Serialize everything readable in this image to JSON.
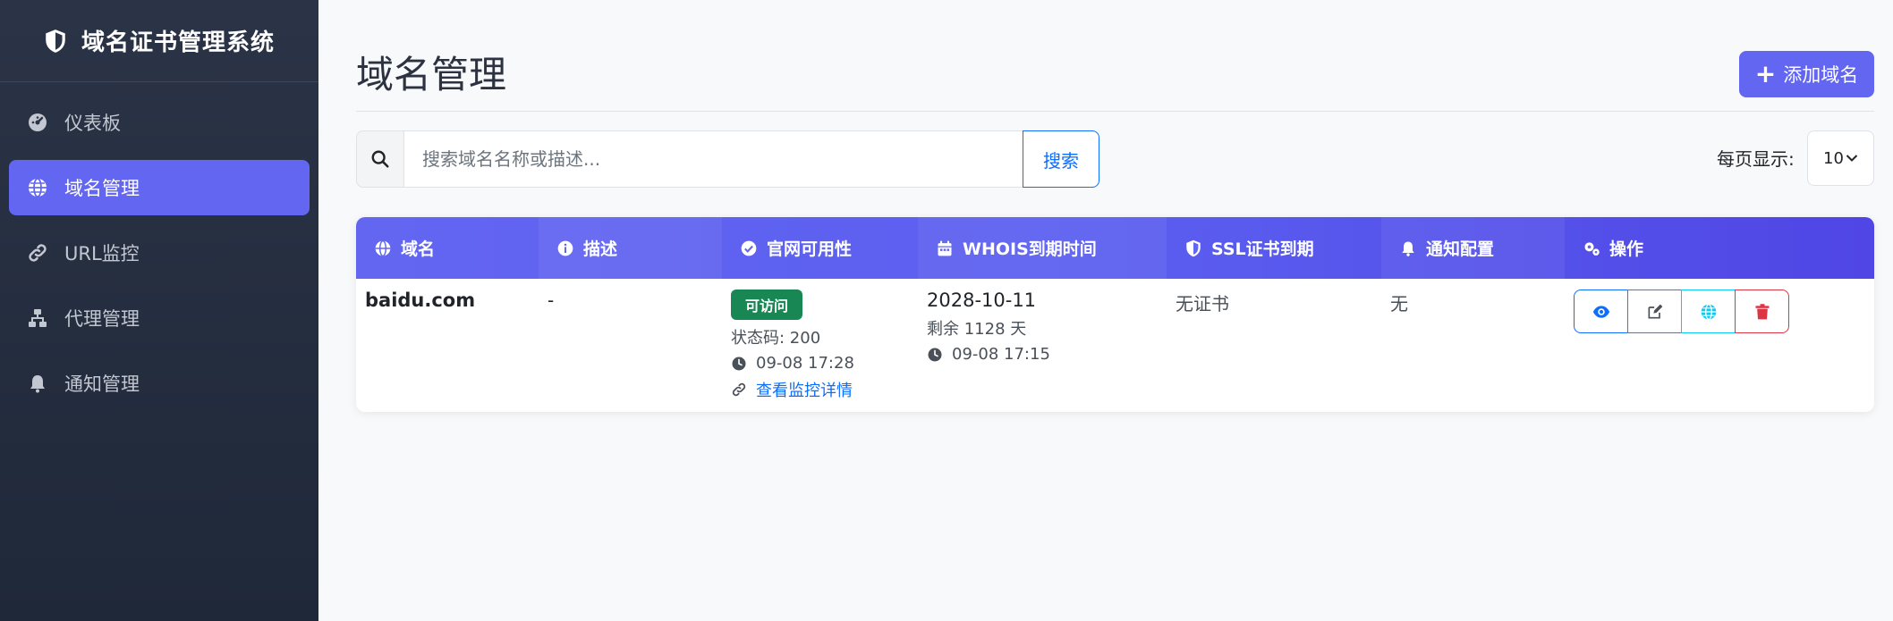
{
  "app": {
    "title": "域名证书管理系统"
  },
  "sidebar": {
    "items": [
      {
        "label": "仪表板",
        "icon": "dashboard-icon",
        "active": false
      },
      {
        "label": "域名管理",
        "icon": "globe-icon",
        "active": true
      },
      {
        "label": "URL监控",
        "icon": "link-icon",
        "active": false
      },
      {
        "label": "代理管理",
        "icon": "network-icon",
        "active": false
      },
      {
        "label": "通知管理",
        "icon": "bell-icon",
        "active": false
      }
    ]
  },
  "main": {
    "title": "域名管理",
    "add_button": "添加域名",
    "search": {
      "placeholder": "搜索域名名称或描述...",
      "value": "",
      "button": "搜索"
    },
    "per_page": {
      "label": "每页显示:",
      "value": "10"
    }
  },
  "table": {
    "headers": [
      "域名",
      "描述",
      "官网可用性",
      "WHOIS到期时间",
      "SSL证书到期",
      "通知配置",
      "操作"
    ],
    "rows": [
      {
        "domain": "baidu.com",
        "description": "-",
        "availability": {
          "badge": "可访问",
          "status_code": "状态码: 200",
          "checked": "09-08 17:28",
          "link": "查看监控详情"
        },
        "whois": {
          "date": "2028-10-11",
          "remaining": "剩余 1128 天",
          "checked": "09-08 17:15"
        },
        "ssl": "无证书",
        "notify": "无"
      }
    ]
  },
  "colors": {
    "primary": "#6366f1",
    "success": "#198754",
    "link": "#0d6efd",
    "danger": "#dc3545",
    "info": "#0dcaf0",
    "sidebar_bg": "#2b3446"
  }
}
